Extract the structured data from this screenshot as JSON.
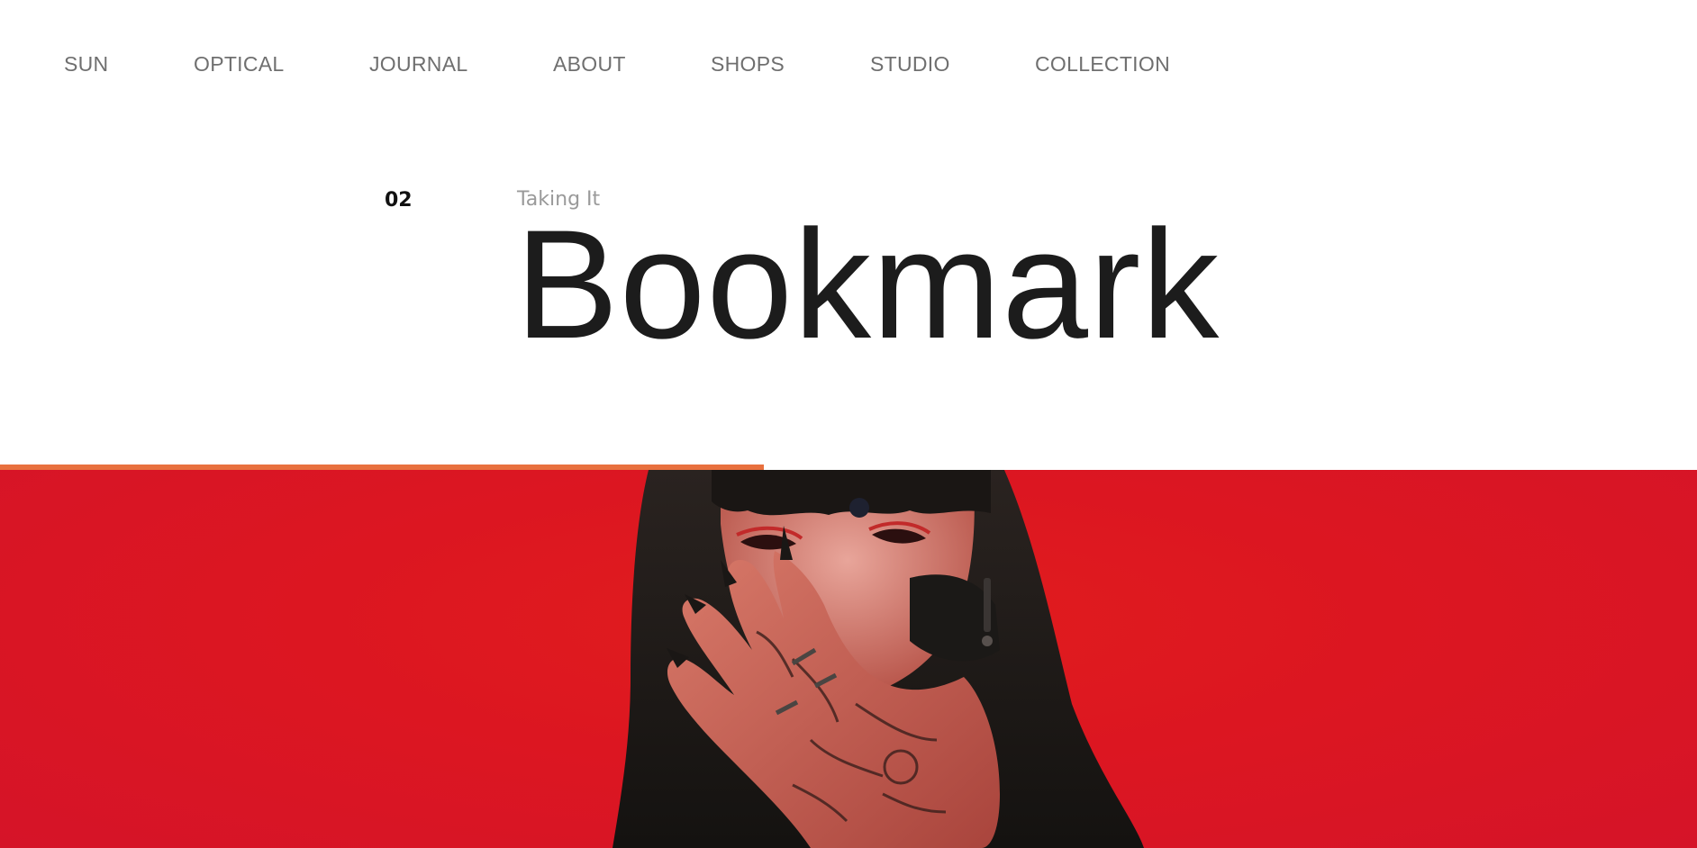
{
  "nav": {
    "items": [
      {
        "label": "SUN"
      },
      {
        "label": "OPTICAL"
      },
      {
        "label": "JOURNAL"
      },
      {
        "label": "ABOUT"
      },
      {
        "label": "SHOPS"
      },
      {
        "label": "STUDIO"
      },
      {
        "label": "COLLECTION"
      }
    ]
  },
  "article": {
    "number": "02",
    "subtitle": "Taking It",
    "title": "Bookmark"
  },
  "progress": {
    "fraction": 0.45,
    "color": "#e8703e"
  },
  "hero": {
    "background_color": "#e01b22"
  }
}
